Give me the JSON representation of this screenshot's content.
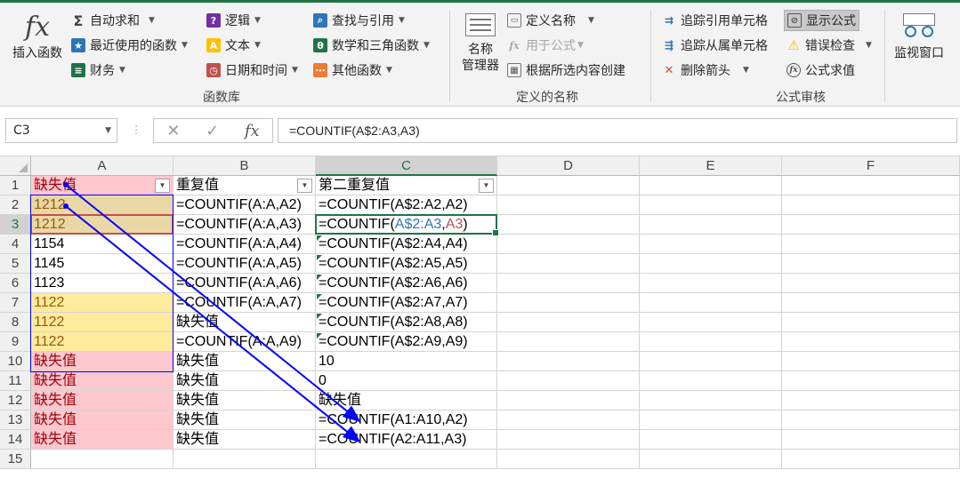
{
  "ribbon": {
    "insert_function": {
      "icon": "fx",
      "label": "插入函数"
    },
    "library": {
      "label": "函数库",
      "autosum": "自动求和",
      "recent": "最近使用的函数",
      "financial": "财务",
      "logical": "逻辑",
      "text": "文本",
      "datetime": "日期和时间",
      "lookup": "查找与引用",
      "math": "数学和三角函数",
      "more": "其他函数"
    },
    "names": {
      "label": "定义的名称",
      "manager_line1": "名称",
      "manager_line2": "管理器",
      "define": "定义名称",
      "use_in_formula": "用于公式",
      "create_from_selection": "根据所选内容创建"
    },
    "audit": {
      "label": "公式审核",
      "trace_precedents": "追踪引用单元格",
      "trace_dependents": "追踪从属单元格",
      "remove_arrows": "删除箭头",
      "show_formulas": "显示公式",
      "error_checking": "错误检查",
      "evaluate": "公式求值"
    },
    "watch_window": "监视窗口"
  },
  "formula_bar": {
    "name_box": "C3",
    "formula": "=COUNTIF(A$2:A3,A3)"
  },
  "columns": [
    "A",
    "B",
    "C",
    "D",
    "E",
    "F"
  ],
  "rows": [
    "1",
    "2",
    "3",
    "4",
    "5",
    "6",
    "7",
    "8",
    "9",
    "10",
    "11",
    "12",
    "13",
    "14",
    "15"
  ],
  "headers": {
    "a": "缺失值",
    "b": "重复值",
    "c": "第二重复值"
  },
  "cells": {
    "a": [
      "1212",
      "1212",
      "1154",
      "1145",
      "1123",
      "1122",
      "1122",
      "1122",
      "缺失值",
      "缺失值",
      "缺失值",
      "缺失值",
      "缺失值"
    ],
    "b": [
      "=COUNTIF(A:A,A2)",
      "=COUNTIF(A:A,A3)",
      "=COUNTIF(A:A,A4)",
      "=COUNTIF(A:A,A5)",
      "=COUNTIF(A:A,A6)",
      "=COUNTIF(A:A,A7)",
      "缺失值",
      "=COUNTIF(A:A,A9)",
      "缺失值",
      "缺失值",
      "缺失值",
      "缺失值",
      "缺失值"
    ],
    "c": [
      "=COUNTIF(A$2:A2,A2)",
      "",
      "=COUNTIF(A$2:A4,A4)",
      "=COUNTIF(A$2:A5,A5)",
      "=COUNTIF(A$2:A6,A6)",
      "=COUNTIF(A$2:A7,A7)",
      "=COUNTIF(A$2:A8,A8)",
      "=COUNTIF(A$2:A9,A9)",
      "10",
      "0",
      "缺失值",
      "=COUNTIF(A1:A10,A2)",
      "=COUNTIF(A2:A11,A3)"
    ]
  },
  "active_formula_parts": {
    "prefix": "=COUNTIF(",
    "range": "A$2:A3",
    "comma": ",",
    "ref": "A3",
    "suffix": ")"
  },
  "colors": {
    "excel_green": "#217346",
    "bad_fill": "#ffc7ce",
    "neutral_fill": "#ffeb9c",
    "arrow": "#0000ff",
    "range_blue": "#2e75b6",
    "range_red": "#c0504d"
  }
}
